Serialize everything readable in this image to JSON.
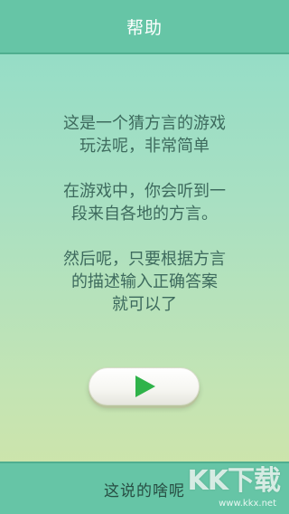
{
  "header": {
    "title": "帮助"
  },
  "help": {
    "paragraphs": [
      [
        "这是一个猜方言的游戏",
        "玩法呢，非常简单"
      ],
      [
        "在游戏中，你会听到一",
        "段来自各地的方言。"
      ],
      [
        "然后呢，只要根据方言",
        "的描述输入正确答案",
        "就可以了"
      ]
    ]
  },
  "play_button": {
    "icon": "play-icon",
    "icon_color": "#2fb34a"
  },
  "footer": {
    "label": "这说的啥呢"
  },
  "watermark": {
    "text": "KK下载",
    "url": "www.kkx.net"
  },
  "colors": {
    "bar": "#66c5a6",
    "text": "#3d6a5d",
    "accent": "#2fb34a"
  }
}
